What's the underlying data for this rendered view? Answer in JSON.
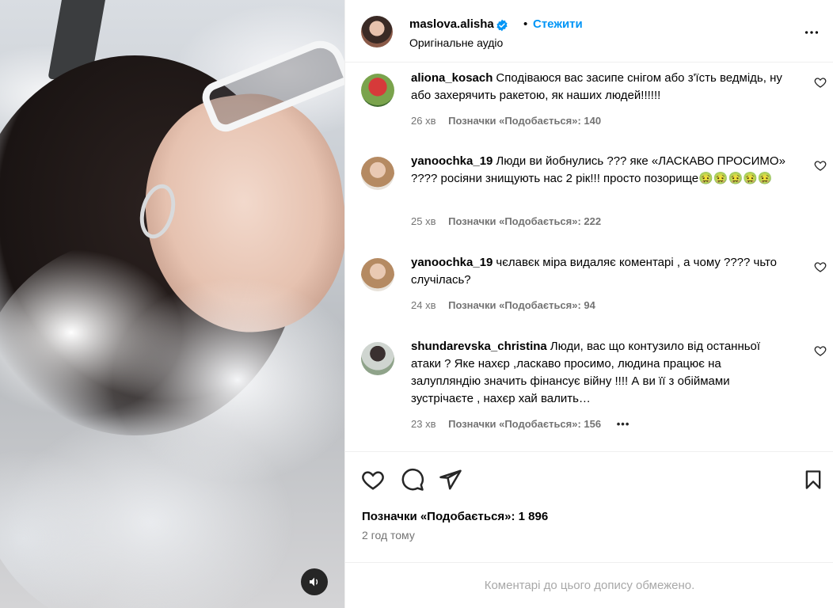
{
  "post": {
    "author": "maslova.alisha",
    "follow_label": "Стежити",
    "separator": "•",
    "audio_label": "Оригінальне аудіо",
    "more_icon": "more-horizontal-icon",
    "verified_icon": "verified-badge-icon"
  },
  "comments": [
    {
      "username": "aliona_kosach",
      "text": "Сподіваюся вас засипе снігом або з'їсть ведмідь, ну або захерячить ракетою, як наших людей!!!!!!",
      "time": "26 хв",
      "likes": "Позначки «Подобається»: 140"
    },
    {
      "username": "yanoochka_19",
      "text": "Люди ви йобнулись ??? яке «ЛАСКАВО ПРОСИМО» ???? росіяни знищують нас 2 рік!!! просто позорище🤢🤢🤢🤢🤢",
      "time": "25 хв",
      "likes": "Позначки «Подобається»: 222"
    },
    {
      "username": "yanoochka_19",
      "text": "чєлавєк міра видаляє коментарі , а чому ???? чьто случілась?",
      "time": "24 хв",
      "likes": "Позначки «Подобається»: 94"
    },
    {
      "username": "shundarevska_christina",
      "text": "Люди, вас що контузило від останньої атаки ? Яке нахєр ,ласкаво просимо, людина працює на залупляндію значить фінансує війну !!!! А ви її з обіймами зустрічаєте , нахєр хай валить…",
      "time": "23 хв",
      "likes": "Позначки «Подобається»: 156",
      "more": "•••"
    }
  ],
  "actions": {
    "likes_total": "Позначки «Подобається»: 1 896",
    "posted_ago": "2 год тому",
    "icons": [
      "heart-icon",
      "comment-icon",
      "share-icon",
      "bookmark-icon"
    ]
  },
  "footer": {
    "restricted_text": "Коментарі до цього допису обмежено."
  },
  "colors": {
    "accent": "#0095f6",
    "muted": "#737373",
    "border": "#efefef"
  }
}
